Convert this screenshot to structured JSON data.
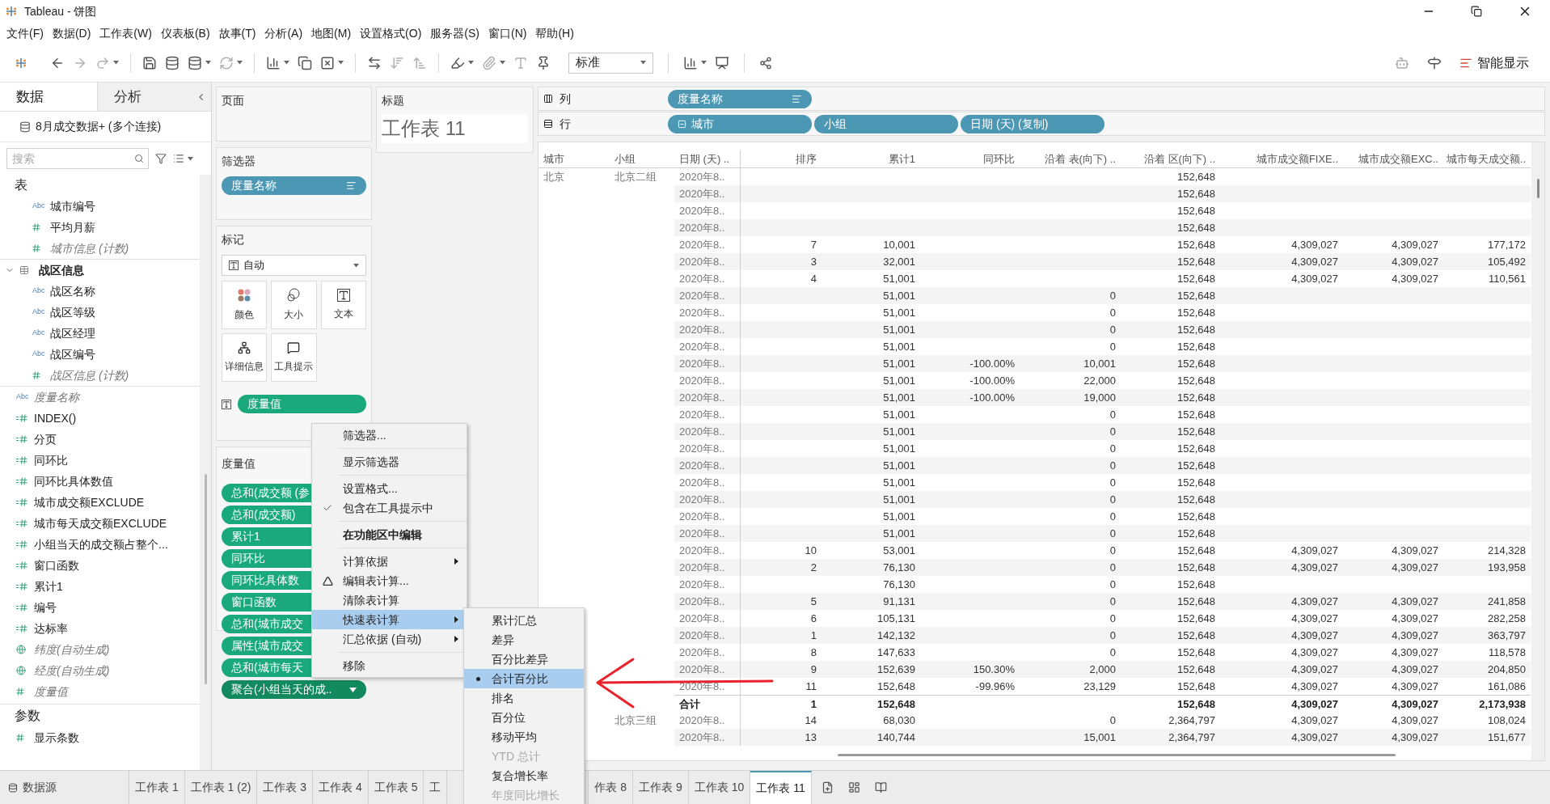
{
  "window": {
    "title": "Tableau - 饼图"
  },
  "menu_bar": [
    "文件(F)",
    "数据(D)",
    "工作表(W)",
    "仪表板(B)",
    "故事(T)",
    "分析(A)",
    "地图(M)",
    "设置格式(O)",
    "服务器(S)",
    "窗口(N)",
    "帮助(H)"
  ],
  "toolbar": {
    "fit_dropdown": "标准",
    "show_me": "智能显示"
  },
  "data_pane": {
    "tabs": [
      {
        "label": "数据",
        "selected": true
      },
      {
        "label": "分析",
        "selected": false
      }
    ],
    "connection": "8月成交数据+ (多个连接)",
    "search": {
      "placeholder": "搜索"
    },
    "tables_heading": "表",
    "fields": [
      {
        "kind": "table",
        "children": [
          {
            "kind": "dimension",
            "badge": "Abc",
            "name": "城市编号",
            "generated": false
          },
          {
            "kind": "measure",
            "name": "平均月薪",
            "generated": false
          },
          {
            "kind": "measure",
            "name": "城市信息 (计数)",
            "generated": true
          }
        ]
      },
      {
        "kind": "table",
        "name": "战区信息",
        "expanded": true,
        "children": [
          {
            "kind": "dimension",
            "badge": "Abc",
            "name": "战区名称",
            "generated": false
          },
          {
            "kind": "dimension",
            "badge": "Abc",
            "name": "战区等级",
            "generated": false
          },
          {
            "kind": "dimension",
            "badge": "Abc",
            "name": "战区经理",
            "generated": false
          },
          {
            "kind": "dimension",
            "badge": "Abc",
            "name": "战区编号",
            "generated": false
          },
          {
            "kind": "measure",
            "name": "战区信息 (计数)",
            "generated": true
          }
        ]
      },
      {
        "kind": "dimension",
        "badge": "Abc",
        "name": "度量名称",
        "generated": true
      },
      {
        "kind": "calc",
        "name": "INDEX()",
        "generated": false
      },
      {
        "kind": "calc",
        "name": "分页",
        "generated": false
      },
      {
        "kind": "calc",
        "name": "同环比",
        "generated": false
      },
      {
        "kind": "calc",
        "name": "同环比具体数值",
        "generated": false
      },
      {
        "kind": "calc",
        "name": "城市成交额EXCLUDE",
        "generated": false
      },
      {
        "kind": "calc",
        "name": "城市每天成交额EXCLUDE",
        "generated": false
      },
      {
        "kind": "calc",
        "name": "小组当天的成交额占整个...",
        "generated": false
      },
      {
        "kind": "calc",
        "name": "窗口函数",
        "generated": false
      },
      {
        "kind": "calc",
        "name": "累计1",
        "generated": false
      },
      {
        "kind": "calc",
        "name": "编号",
        "generated": false
      },
      {
        "kind": "calc",
        "name": "达标率",
        "generated": false
      },
      {
        "kind": "geo",
        "name": "纬度(自动生成)",
        "generated": true
      },
      {
        "kind": "geo",
        "name": "经度(自动生成)",
        "generated": true
      },
      {
        "kind": "measure",
        "name": "度量值",
        "generated": true
      }
    ],
    "parameters_heading": "参数",
    "parameters": [
      {
        "kind": "measure",
        "name": "显示条数",
        "generated": false
      }
    ]
  },
  "pages_card": {
    "heading": "页面"
  },
  "filters_card": {
    "heading": "筛选器",
    "pills": [
      "度量名称"
    ]
  },
  "marks_card": {
    "heading": "标记",
    "mark_type": "自动",
    "buttons": [
      "颜色",
      "大小",
      "文本",
      "详细信息",
      "工具提示"
    ],
    "pills": [
      "度量值"
    ]
  },
  "measure_values_card": {
    "heading": "度量值",
    "pills": [
      {
        "label": "总和(成交额 (参",
        "active": false
      },
      {
        "label": "总和(成交额)",
        "active": false
      },
      {
        "label": "累计1",
        "active": false
      },
      {
        "label": "同环比",
        "active": false
      },
      {
        "label": "同环比具体数",
        "active": false
      },
      {
        "label": "窗口函数",
        "active": false
      },
      {
        "label": "总和(城市成交",
        "active": false
      },
      {
        "label": "属性(城市成交",
        "active": false
      },
      {
        "label": "总和(城市每天",
        "active": false
      },
      {
        "label": "聚合(小组当天的成..",
        "active": true
      }
    ]
  },
  "title_card": {
    "heading": "标题",
    "title": "工作表 11"
  },
  "shelves": [
    {
      "label": "列",
      "kind": "columns",
      "pills": [
        {
          "label": "度量名称",
          "kind": "sorted"
        }
      ]
    },
    {
      "label": "行",
      "kind": "rows",
      "pills": [
        {
          "label": "城市",
          "kind": "collapsible"
        },
        {
          "label": "小组",
          "kind": "plain"
        },
        {
          "label": "日期 (天) (复制)",
          "kind": "plain"
        }
      ]
    }
  ],
  "table": {
    "columns": [
      "城市",
      "小组",
      "日期 (天) ..",
      "排序",
      "累计1",
      "同环比",
      "沿着 表(向下) ..",
      "沿着 区(向下) ..",
      "城市成交额FIXE..",
      "城市成交额EXC..",
      "城市每天成交额.."
    ],
    "rows": [
      {
        "kind": "data",
        "cells": [
          "北京",
          "北京二组",
          "2020年8..",
          null,
          null,
          null,
          null,
          "152,648",
          null,
          null,
          null
        ]
      },
      {
        "kind": "data",
        "cells": [
          null,
          null,
          "2020年8..",
          null,
          null,
          null,
          null,
          "152,648",
          null,
          null,
          null
        ]
      },
      {
        "kind": "data",
        "cells": [
          null,
          null,
          "2020年8..",
          null,
          null,
          null,
          null,
          "152,648",
          null,
          null,
          null
        ]
      },
      {
        "kind": "data",
        "cells": [
          null,
          null,
          "2020年8..",
          null,
          null,
          null,
          null,
          "152,648",
          null,
          null,
          null
        ]
      },
      {
        "kind": "data",
        "cells": [
          null,
          null,
          "2020年8..",
          "7",
          "10,001",
          null,
          null,
          "152,648",
          "4,309,027",
          "4,309,027",
          "177,172"
        ]
      },
      {
        "kind": "data",
        "cells": [
          null,
          null,
          "2020年8..",
          "3",
          "32,001",
          null,
          null,
          "152,648",
          "4,309,027",
          "4,309,027",
          "105,492"
        ]
      },
      {
        "kind": "data",
        "cells": [
          null,
          null,
          "2020年8..",
          "4",
          "51,001",
          null,
          null,
          "152,648",
          "4,309,027",
          "4,309,027",
          "110,561"
        ]
      },
      {
        "kind": "data",
        "cells": [
          null,
          null,
          "2020年8..",
          null,
          "51,001",
          null,
          "0",
          "152,648",
          null,
          null,
          null
        ]
      },
      {
        "kind": "data",
        "cells": [
          null,
          null,
          "2020年8..",
          null,
          "51,001",
          null,
          "0",
          "152,648",
          null,
          null,
          null
        ]
      },
      {
        "kind": "data",
        "cells": [
          null,
          null,
          "2020年8..",
          null,
          "51,001",
          null,
          "0",
          "152,648",
          null,
          null,
          null
        ]
      },
      {
        "kind": "data",
        "cells": [
          null,
          null,
          "2020年8..",
          null,
          "51,001",
          null,
          "0",
          "152,648",
          null,
          null,
          null
        ]
      },
      {
        "kind": "data",
        "cells": [
          null,
          null,
          "2020年8..",
          null,
          "51,001",
          "-100.00%",
          "10,001",
          "152,648",
          null,
          null,
          null
        ]
      },
      {
        "kind": "data",
        "cells": [
          null,
          null,
          "2020年8..",
          null,
          "51,001",
          "-100.00%",
          "22,000",
          "152,648",
          null,
          null,
          null
        ]
      },
      {
        "kind": "data",
        "cells": [
          null,
          null,
          "2020年8..",
          null,
          "51,001",
          "-100.00%",
          "19,000",
          "152,648",
          null,
          null,
          null
        ]
      },
      {
        "kind": "data",
        "cells": [
          null,
          null,
          "2020年8..",
          null,
          "51,001",
          null,
          "0",
          "152,648",
          null,
          null,
          null
        ]
      },
      {
        "kind": "data",
        "cells": [
          null,
          null,
          "2020年8..",
          null,
          "51,001",
          null,
          "0",
          "152,648",
          null,
          null,
          null
        ]
      },
      {
        "kind": "data",
        "cells": [
          null,
          null,
          "2020年8..",
          null,
          "51,001",
          null,
          "0",
          "152,648",
          null,
          null,
          null
        ]
      },
      {
        "kind": "data",
        "cells": [
          null,
          null,
          "2020年8..",
          null,
          "51,001",
          null,
          "0",
          "152,648",
          null,
          null,
          null
        ]
      },
      {
        "kind": "data",
        "cells": [
          null,
          null,
          "2020年8..",
          null,
          "51,001",
          null,
          "0",
          "152,648",
          null,
          null,
          null
        ]
      },
      {
        "kind": "data",
        "cells": [
          null,
          null,
          "2020年8..",
          null,
          "51,001",
          null,
          "0",
          "152,648",
          null,
          null,
          null
        ]
      },
      {
        "kind": "data",
        "cells": [
          null,
          null,
          "2020年8..",
          null,
          "51,001",
          null,
          "0",
          "152,648",
          null,
          null,
          null
        ]
      },
      {
        "kind": "data",
        "cells": [
          null,
          null,
          "2020年8..",
          null,
          "51,001",
          null,
          "0",
          "152,648",
          null,
          null,
          null
        ]
      },
      {
        "kind": "data",
        "cells": [
          null,
          null,
          "2020年8..",
          "10",
          "53,001",
          null,
          "0",
          "152,648",
          "4,309,027",
          "4,309,027",
          "214,328"
        ]
      },
      {
        "kind": "data",
        "cells": [
          null,
          null,
          "2020年8..",
          "2",
          "76,130",
          null,
          "0",
          "152,648",
          "4,309,027",
          "4,309,027",
          "193,958"
        ]
      },
      {
        "kind": "data",
        "cells": [
          null,
          null,
          "2020年8..",
          null,
          "76,130",
          null,
          "0",
          "152,648",
          null,
          null,
          null
        ]
      },
      {
        "kind": "data",
        "cells": [
          null,
          null,
          "2020年8..",
          "5",
          "91,131",
          null,
          "0",
          "152,648",
          "4,309,027",
          "4,309,027",
          "241,858"
        ]
      },
      {
        "kind": "data",
        "cells": [
          null,
          null,
          "2020年8..",
          "6",
          "105,131",
          null,
          "0",
          "152,648",
          "4,309,027",
          "4,309,027",
          "282,258"
        ]
      },
      {
        "kind": "data",
        "cells": [
          null,
          null,
          "2020年8..",
          "1",
          "142,132",
          null,
          "0",
          "152,648",
          "4,309,027",
          "4,309,027",
          "363,797"
        ]
      },
      {
        "kind": "data",
        "cells": [
          null,
          null,
          "2020年8..",
          "8",
          "147,633",
          null,
          "0",
          "152,648",
          "4,309,027",
          "4,309,027",
          "118,578"
        ]
      },
      {
        "kind": "data",
        "cells": [
          null,
          null,
          "2020年8..",
          "9",
          "152,639",
          "150.30%",
          "2,000",
          "152,648",
          "4,309,027",
          "4,309,027",
          "204,850"
        ]
      },
      {
        "kind": "data",
        "cells": [
          null,
          null,
          "2020年8..",
          "11",
          "152,648",
          "-99.96%",
          "23,129",
          "152,648",
          "4,309,027",
          "4,309,027",
          "161,086"
        ]
      },
      {
        "kind": "total",
        "cells": [
          null,
          null,
          "合计",
          "1",
          "152,648",
          null,
          null,
          "152,648",
          "4,309,027",
          "4,309,027",
          "2,173,938"
        ]
      },
      {
        "kind": "data",
        "cells": [
          null,
          "北京三组",
          "2020年8..",
          "14",
          "68,030",
          null,
          "0",
          "2,364,797",
          "4,309,027",
          "4,309,027",
          "108,024"
        ]
      },
      {
        "kind": "data",
        "cells": [
          null,
          null,
          "2020年8..",
          "13",
          "140,744",
          null,
          "15,001",
          "2,364,797",
          "4,309,027",
          "4,309,027",
          "151,677"
        ]
      }
    ]
  },
  "context_menu": {
    "groups": [
      [
        {
          "label": "筛选器...",
          "kind": "plain",
          "checked": false,
          "submenu": false,
          "highlighted": false
        }
      ],
      [
        {
          "label": "显示筛选器",
          "kind": "plain",
          "checked": false,
          "submenu": false,
          "highlighted": false
        }
      ],
      [
        {
          "label": "设置格式...",
          "kind": "plain",
          "checked": false,
          "submenu": false,
          "highlighted": false
        },
        {
          "label": "包含在工具提示中",
          "kind": "plain",
          "checked": true,
          "submenu": false,
          "highlighted": false
        }
      ],
      [
        {
          "label": "在功能区中编辑",
          "kind": "default",
          "checked": false,
          "submenu": false,
          "highlighted": false
        }
      ],
      [
        {
          "label": "计算依据",
          "kind": "plain",
          "checked": false,
          "submenu": true,
          "highlighted": false
        },
        {
          "label": "编辑表计算...",
          "kind": "table_calc",
          "checked": false,
          "submenu": false,
          "highlighted": false
        },
        {
          "label": "清除表计算",
          "kind": "plain",
          "checked": false,
          "submenu": false,
          "highlighted": false
        },
        {
          "label": "快速表计算",
          "kind": "plain",
          "checked": false,
          "submenu": true,
          "highlighted": true
        },
        {
          "label": "汇总依据 (自动)",
          "kind": "plain",
          "checked": false,
          "submenu": true,
          "highlighted": false
        }
      ],
      [
        {
          "label": "移除",
          "kind": "plain",
          "checked": false,
          "submenu": false,
          "highlighted": false
        }
      ]
    ]
  },
  "submenu": {
    "items": [
      {
        "label": "累计汇总",
        "selected": false,
        "disabled": false
      },
      {
        "label": "差异",
        "selected": false,
        "disabled": false
      },
      {
        "label": "百分比差异",
        "selected": false,
        "disabled": false
      },
      {
        "label": "合计百分比",
        "selected": true,
        "disabled": false
      },
      {
        "label": "排名",
        "selected": false,
        "disabled": false
      },
      {
        "label": "百分位",
        "selected": false,
        "disabled": false
      },
      {
        "label": "移动平均",
        "selected": false,
        "disabled": false
      },
      {
        "label": "YTD 总计",
        "selected": false,
        "disabled": true
      },
      {
        "label": "复合增长率",
        "selected": false,
        "disabled": false
      },
      {
        "label": "年度同比增长",
        "selected": false,
        "disabled": true
      }
    ]
  },
  "sheet_bar": {
    "data_source": "数据源",
    "tabs": [
      {
        "label": "工作表 1",
        "selected": false
      },
      {
        "label": "工作表 1 (2)",
        "selected": false
      },
      {
        "label": "工作表 3",
        "selected": false
      },
      {
        "label": "工作表 4",
        "selected": false
      },
      {
        "label": "工作表 5",
        "selected": false
      },
      {
        "label": "工",
        "selected": false
      },
      {
        "label": "作表 8",
        "selected": false
      },
      {
        "label": "工作表 9",
        "selected": false
      },
      {
        "label": "工作表 10",
        "selected": false
      },
      {
        "label": "工作表 11",
        "selected": true
      }
    ]
  }
}
